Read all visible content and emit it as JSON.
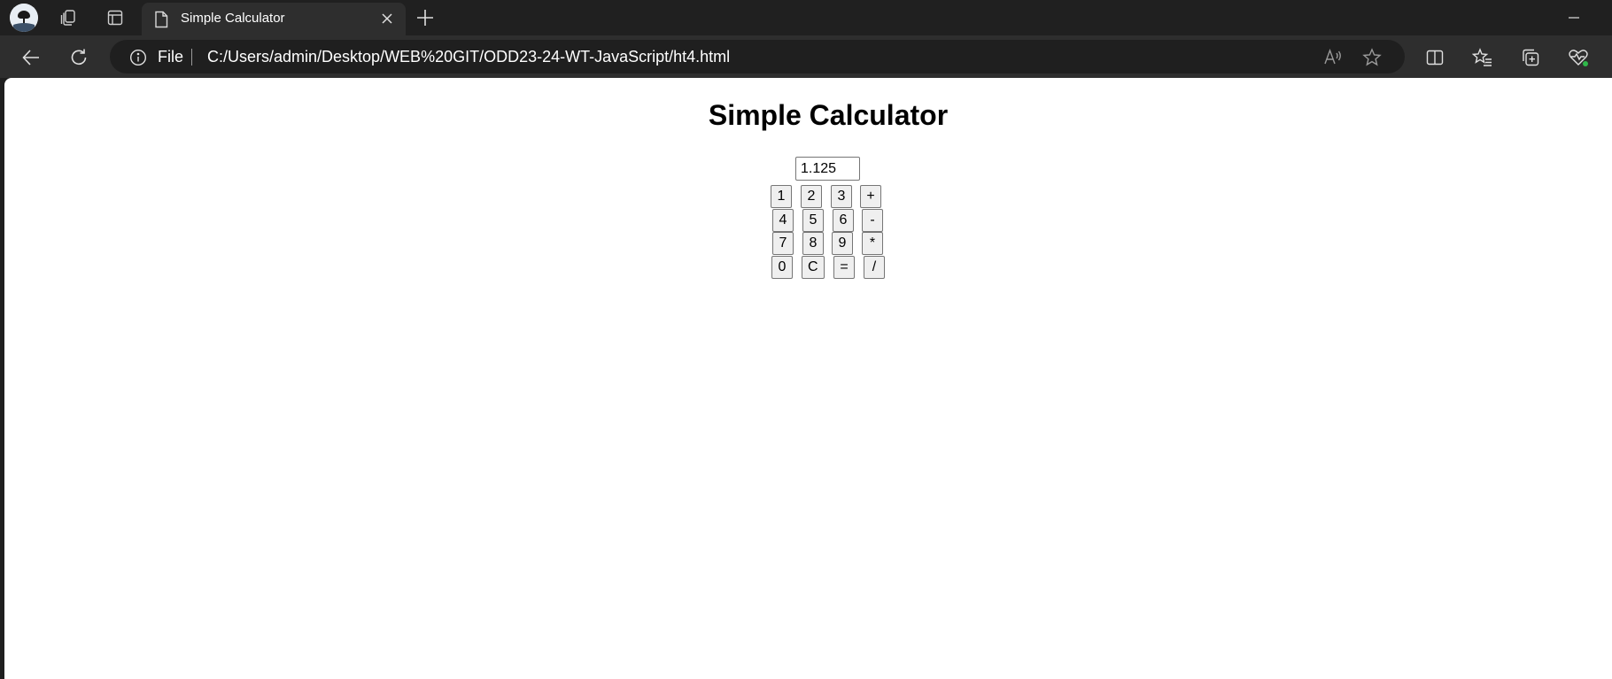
{
  "browser": {
    "tab": {
      "title": "Simple Calculator"
    },
    "address": {
      "scheme_label": "File",
      "url": "C:/Users/admin/Desktop/WEB%20GIT/ODD23-24-WT-JavaScript/ht4.html"
    },
    "icons": {
      "profile": "profile-avatar-icon",
      "workspaces": "workspaces-icon",
      "tab_actions": "tab-actions-icon",
      "tab_page": "document-icon",
      "close": "close-icon",
      "new_tab": "plus-icon",
      "minimize": "minimize-icon",
      "back": "arrow-left-icon",
      "refresh": "refresh-icon",
      "info": "info-icon",
      "read_aloud": "read-aloud-icon",
      "favorite": "star-icon",
      "split_screen": "split-screen-icon",
      "favorites": "favorites-icon",
      "collections": "collections-icon",
      "browser_essentials": "heart-pulse-icon"
    }
  },
  "page": {
    "heading": "Simple Calculator",
    "display_value": "1.125",
    "keys": [
      [
        "1",
        "2",
        "3",
        "+"
      ],
      [
        "4",
        "5",
        "6",
        "-"
      ],
      [
        "7",
        "8",
        "9",
        "*"
      ],
      [
        "0",
        "C",
        "=",
        "/"
      ]
    ]
  },
  "colors": {
    "chrome_dark": "#202020",
    "toolbar": "#2e2e2e",
    "omnibox": "#1f1f1f",
    "page_bg": "#ffffff",
    "button_bg": "#efefef",
    "button_border": "#767676"
  }
}
